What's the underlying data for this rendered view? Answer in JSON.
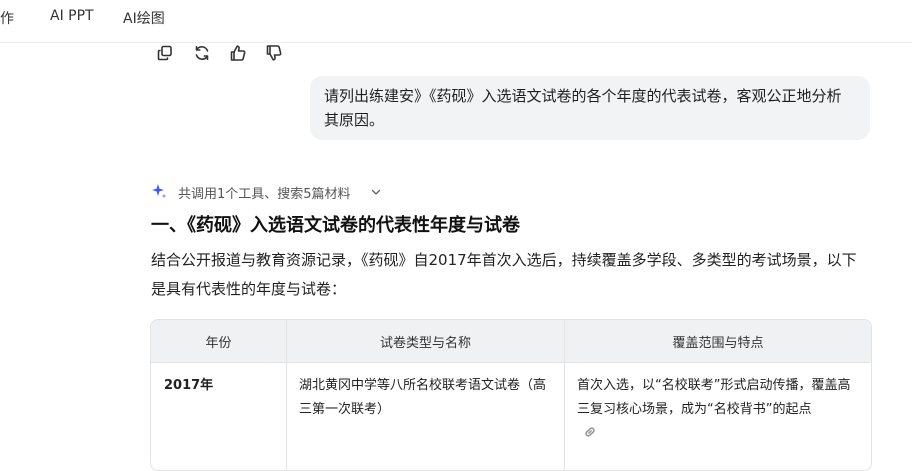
{
  "nav": {
    "tabs": [
      {
        "label": "写作"
      },
      {
        "label": "AI PPT"
      },
      {
        "label": "AI绘图"
      }
    ]
  },
  "actions": [
    {
      "icon": "copy-icon"
    },
    {
      "icon": "regenerate-icon"
    },
    {
      "icon": "thumbs-up-icon"
    },
    {
      "icon": "thumbs-down-icon"
    }
  ],
  "user_message": "请列出练建安》《药砚》入选语文试卷的各个年度的代表试卷，客观公正地分析其原因。",
  "tools_summary": "共调用1个工具、搜索5篇材料",
  "answer": {
    "heading": "一、《药砚》入选语文试卷的代表性年度与试卷",
    "paragraph": "结合公开报道与教育资源记录，《药砚》自2017年首次入选后，持续覆盖多学段、多类型的考试场景，以下是具有代表性的年度与试卷："
  },
  "table": {
    "headers": [
      "年份",
      "试卷类型与名称",
      "覆盖范围与特点"
    ],
    "rows": [
      {
        "year": "2017年",
        "paper": "湖北黄冈中学等八所名校联考语文试卷（高三第一次联考）",
        "scope": "首次入选，以“名校联考”形式启动传播，覆盖高三复习核心场景，成为“名校背书”的起点"
      }
    ]
  },
  "colors": {
    "bubble_bg": "#f2f3f5",
    "table_header_bg": "#f0f1f3",
    "sparkle": "#3b5bff"
  }
}
